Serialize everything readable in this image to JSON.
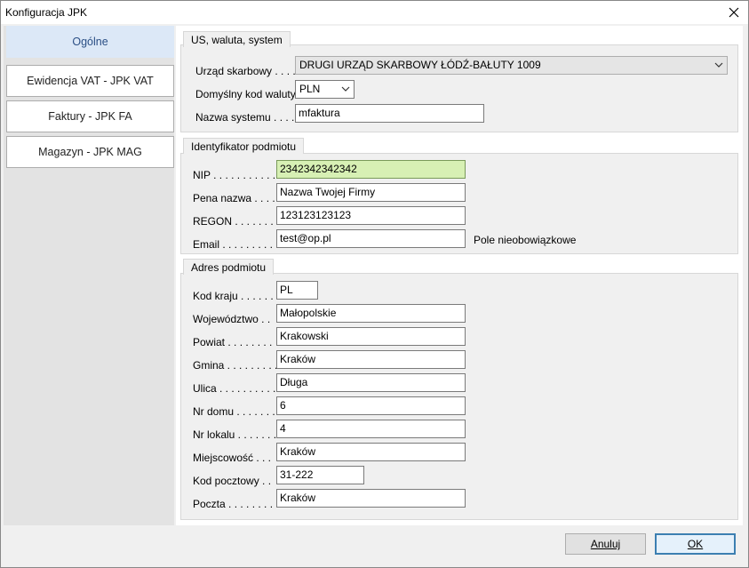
{
  "window": {
    "title": "Konfiguracja JPK"
  },
  "sidebar": {
    "items": [
      {
        "label": "Ogólne"
      },
      {
        "label": "Ewidencja VAT - JPK VAT"
      },
      {
        "label": "Faktury - JPK FA"
      },
      {
        "label": "Magazyn - JPK MAG"
      }
    ]
  },
  "group_us": {
    "title": "US, waluta, system",
    "office_label": "Urząd skarbowy . . . .",
    "office_value": "DRUGI URZĄD SKARBOWY ŁÓDŹ-BAŁUTY  1009",
    "currency_label": "Domyślny kod waluty",
    "currency_value": "PLN",
    "system_label": "Nazwa systemu . . . .",
    "system_value": "mfaktura"
  },
  "group_id": {
    "title": "Identyfikator podmiotu",
    "nip_label": "NIP . . . . . . . . . . .",
    "nip_value": "2342342342342",
    "name_label": "Pena nazwa . . . .",
    "name_value": "Nazwa Twojej Firmy",
    "regon_label": "REGON . . . . . . .",
    "regon_value": "123123123123",
    "email_label": "Email . . . . . . . . .",
    "email_value": "test@op.pl",
    "optional_note": "Pole nieobowiązkowe"
  },
  "group_addr": {
    "title": "Adres podmiotu",
    "country_label": "Kod kraju . . . . . .",
    "country_value": "PL",
    "voivodeship_label": "Województwo . .",
    "voivodeship_value": "Małopolskie",
    "county_label": "Powiat . . . . . . . .",
    "county_value": "Krakowski",
    "commune_label": "Gmina . . . . . . . . .",
    "commune_value": "Kraków",
    "street_label": "Ulica . . . . . . . . . .",
    "street_value": "Długa",
    "house_label": "Nr domu . . . . . . .",
    "house_value": "6",
    "flat_label": "Nr lokalu . . . . . . .",
    "flat_value": "4",
    "city_label": "Miejscowość . . .",
    "city_value": "Kraków",
    "postcode_label": "Kod pocztowy . .",
    "postcode_value": "31-222",
    "post_label": "Poczta . . . . . . . .",
    "post_value": "Kraków"
  },
  "footer": {
    "cancel_label": "Anuluj",
    "ok_label": "OK"
  }
}
